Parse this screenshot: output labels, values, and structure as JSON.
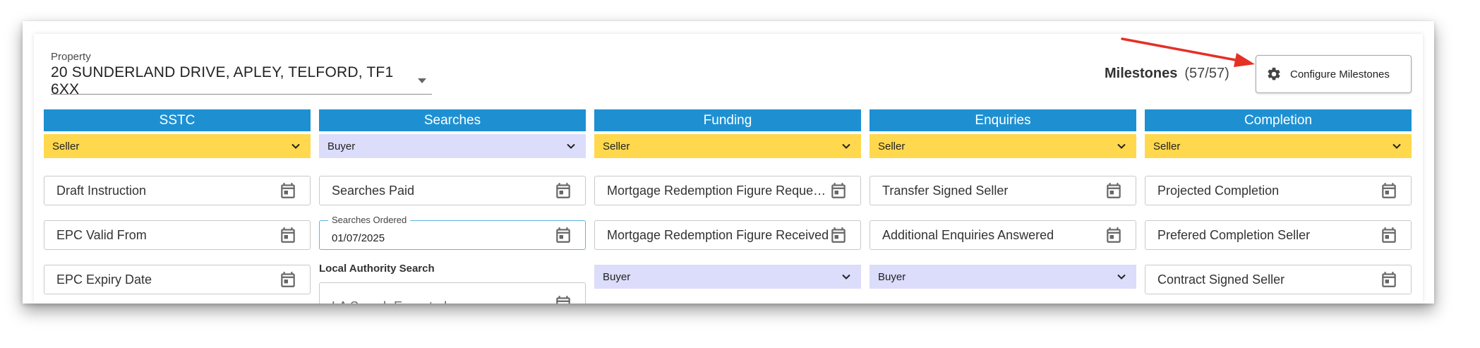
{
  "property": {
    "label": "Property",
    "value": "20 SUNDERLAND DRIVE, APLEY, TELFORD, TF1 6XX"
  },
  "milestones": {
    "title": "Milestones",
    "count": "(57/57)",
    "configure_label": "Configure Milestones"
  },
  "colors": {
    "header": "#1e90d2",
    "seller": "#ffd84d",
    "buyer": "#dcdcfb",
    "arrow": "#e53025"
  },
  "columns": [
    {
      "title": "SSTC",
      "role": "Seller",
      "fields": [
        {
          "label": "Draft Instruction"
        },
        {
          "label": "EPC Valid From"
        },
        {
          "label": "EPC Expiry Date"
        }
      ]
    },
    {
      "title": "Searches",
      "role": "Buyer",
      "fields": [
        {
          "label": "Searches Paid"
        },
        {
          "label": "Searches Ordered",
          "value": "01/07/2025"
        }
      ],
      "sub_label": "Local Authority Search",
      "partial_field": "LA Search Expected"
    },
    {
      "title": "Funding",
      "role": "Seller",
      "fields": [
        {
          "label": "Mortgage Redemption Figure Requested"
        },
        {
          "label": "Mortgage Redemption Figure Received"
        }
      ],
      "role2": "Buyer"
    },
    {
      "title": "Enquiries",
      "role": "Seller",
      "fields": [
        {
          "label": "Transfer Signed Seller"
        },
        {
          "label": "Additional Enquiries Answered"
        }
      ],
      "role2": "Buyer"
    },
    {
      "title": "Completion",
      "role": "Seller",
      "fields": [
        {
          "label": "Projected Completion"
        },
        {
          "label": "Prefered Completion Seller"
        },
        {
          "label": "Contract Signed Seller"
        }
      ]
    }
  ]
}
